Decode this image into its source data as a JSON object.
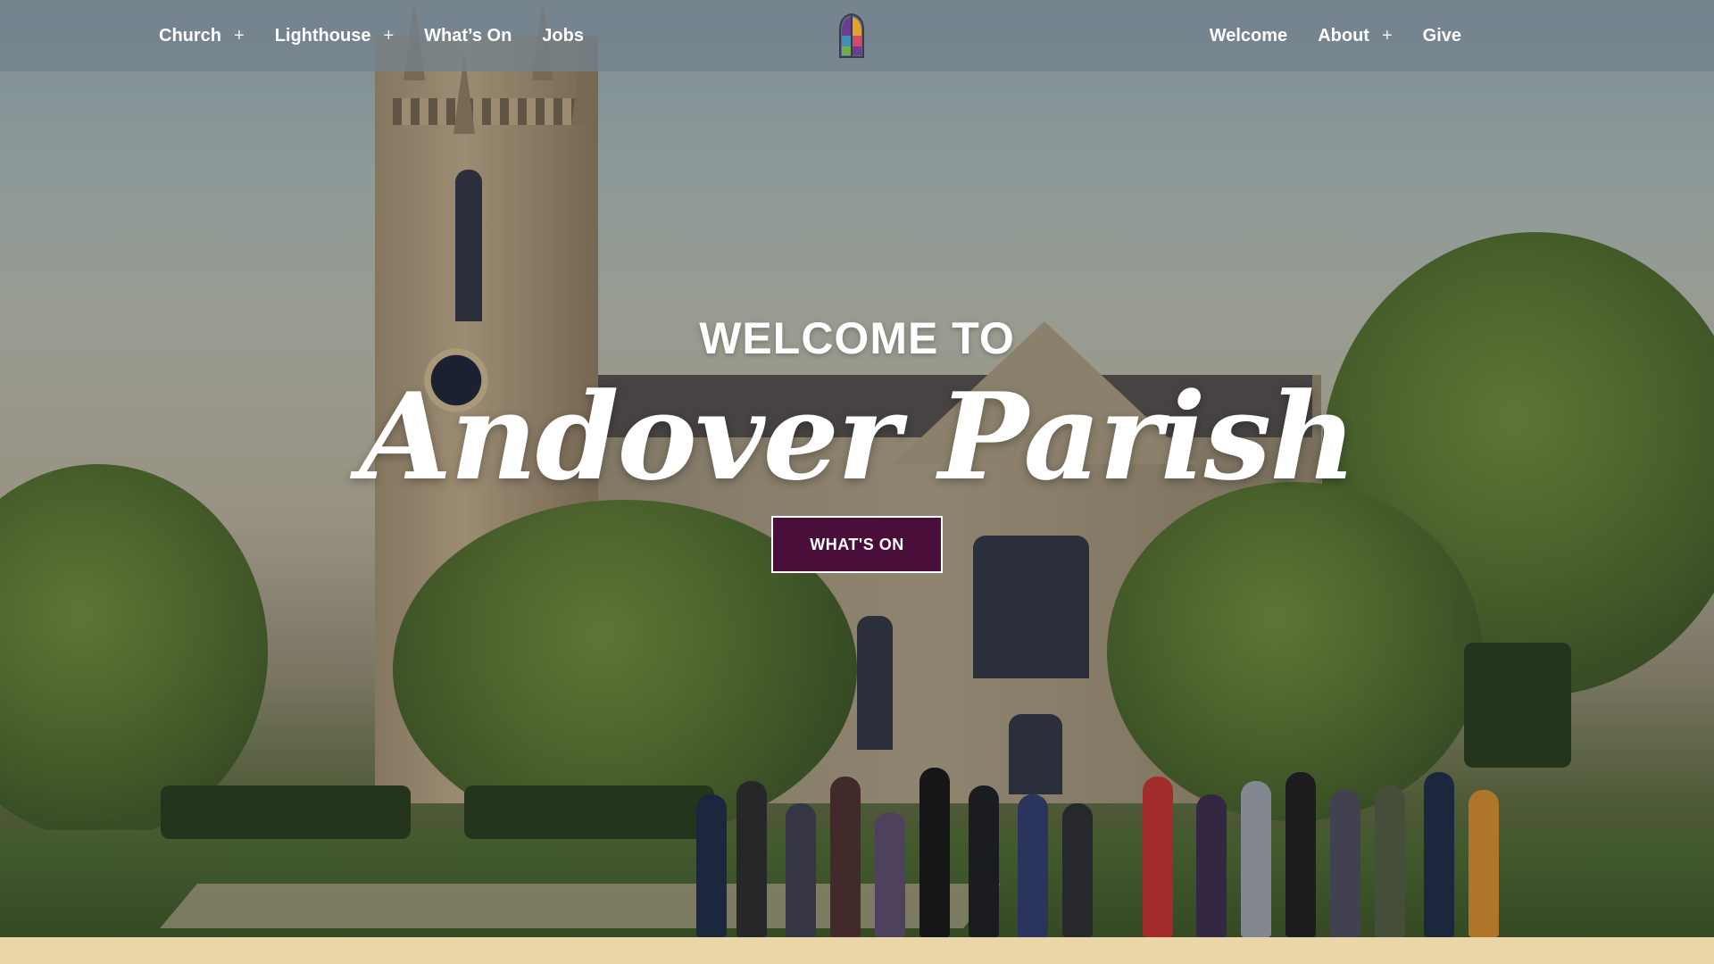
{
  "nav": {
    "left": [
      {
        "label": "Church",
        "has_submenu": true
      },
      {
        "label": "Lighthouse",
        "has_submenu": true
      },
      {
        "label": "What’s On",
        "has_submenu": false
      },
      {
        "label": "Jobs",
        "has_submenu": false
      }
    ],
    "right": [
      {
        "label": "Welcome",
        "has_submenu": false
      },
      {
        "label": "About",
        "has_submenu": true
      },
      {
        "label": "Give",
        "has_submenu": false
      }
    ],
    "submenu_symbol": "+",
    "logo_icon": "stained-glass-window-logo"
  },
  "hero": {
    "welcome": "WELCOME TO",
    "title": "Andover Parish",
    "cta_label": "WHAT'S ON",
    "background_icon": "church-photo"
  },
  "colors": {
    "cta_background": "#4a0e3a",
    "nav_background": "#73828c",
    "bottom_band": "#ead6a8"
  }
}
